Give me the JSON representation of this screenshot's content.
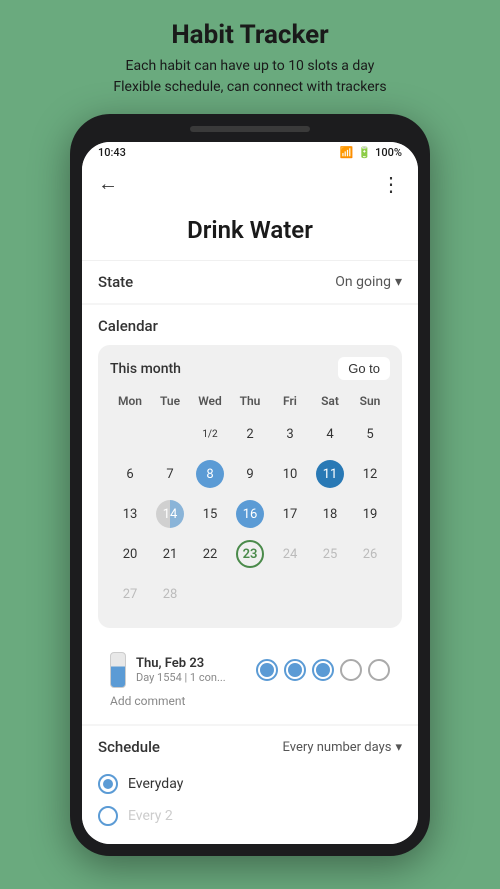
{
  "header": {
    "title": "Habit Tracker",
    "subtitle_line1": "Each habit can have up to 10 slots a day",
    "subtitle_line2": "Flexible schedule, can connect with trackers"
  },
  "status_bar": {
    "time": "10:43",
    "battery": "100%"
  },
  "nav": {
    "back_icon": "←",
    "more_icon": "⋮"
  },
  "page": {
    "title": "Drink Water"
  },
  "state": {
    "label": "State",
    "value": "On going",
    "dropdown_icon": "▾"
  },
  "calendar": {
    "section_label": "Calendar",
    "month": "This month",
    "goto_label": "Go to",
    "day_headers": [
      "Mon",
      "Tue",
      "Wed",
      "Thu",
      "Fri",
      "Sat",
      "Sun"
    ],
    "weeks": [
      [
        {
          "num": "",
          "type": "empty"
        },
        {
          "num": "",
          "type": "empty"
        },
        {
          "num": "1/2",
          "type": "small-text"
        },
        {
          "num": "2",
          "type": "normal"
        },
        {
          "num": "3",
          "type": "normal"
        },
        {
          "num": "4",
          "type": "normal"
        },
        {
          "num": "5",
          "type": "normal"
        }
      ],
      [
        {
          "num": "6",
          "type": "normal"
        },
        {
          "num": "7",
          "type": "normal"
        },
        {
          "num": "8",
          "type": "highlighted"
        },
        {
          "num": "9",
          "type": "normal"
        },
        {
          "num": "10",
          "type": "normal"
        },
        {
          "num": "11",
          "type": "highlighted-dark"
        },
        {
          "num": "12",
          "type": "normal"
        }
      ],
      [
        {
          "num": "13",
          "type": "normal"
        },
        {
          "num": "14",
          "type": "partial"
        },
        {
          "num": "15",
          "type": "normal"
        },
        {
          "num": "16",
          "type": "highlighted"
        },
        {
          "num": "17",
          "type": "normal"
        },
        {
          "num": "18",
          "type": "normal"
        },
        {
          "num": "19",
          "type": "normal"
        }
      ],
      [
        {
          "num": "20",
          "type": "normal"
        },
        {
          "num": "21",
          "type": "normal"
        },
        {
          "num": "22",
          "type": "normal"
        },
        {
          "num": "23",
          "type": "today"
        },
        {
          "num": "24",
          "type": "dim"
        },
        {
          "num": "25",
          "type": "dim"
        },
        {
          "num": "26",
          "type": "dim"
        }
      ],
      [
        {
          "num": "27",
          "type": "dim"
        },
        {
          "num": "28",
          "type": "dim"
        },
        {
          "num": "",
          "type": "empty"
        },
        {
          "num": "",
          "type": "empty"
        },
        {
          "num": "",
          "type": "empty"
        },
        {
          "num": "",
          "type": "empty"
        },
        {
          "num": "",
          "type": "empty"
        }
      ]
    ]
  },
  "day_entry": {
    "date": "Thu, Feb 23",
    "sub": "Day 1554 | 1 con...",
    "dots": [
      {
        "type": "filled"
      },
      {
        "type": "filled"
      },
      {
        "type": "filled"
      },
      {
        "type": "empty"
      },
      {
        "type": "empty"
      }
    ],
    "add_comment": "Add comment"
  },
  "schedule": {
    "label": "Schedule",
    "value": "Every number days",
    "dropdown_icon": "▾",
    "options": [
      {
        "label": "Everyday",
        "selected": true
      },
      {
        "label": "Every 2",
        "selected": false
      }
    ]
  }
}
